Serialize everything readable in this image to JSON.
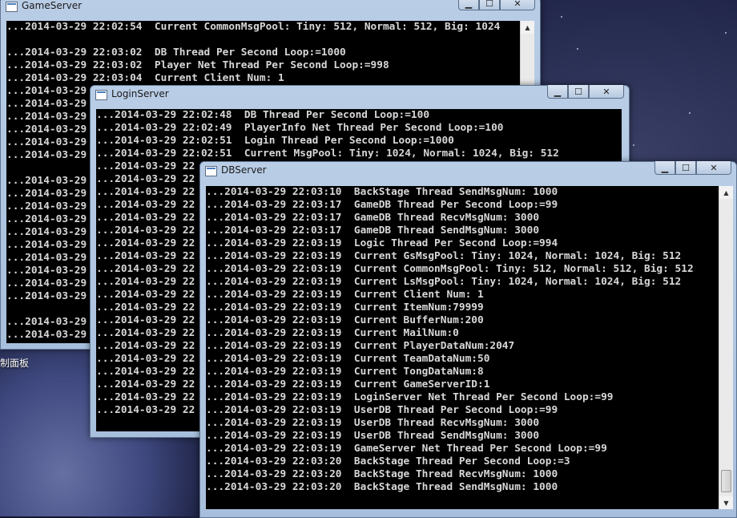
{
  "desktop": {
    "label": "制面板"
  },
  "windows": {
    "game": {
      "title": "GameServer",
      "lines": [
        "...2014-03-29 22:02:54  Current CommonMsgPool: Tiny: 512, Normal: 512, Big: 1024",
        "",
        "...2014-03-29 22:03:02  DB Thread Per Second Loop:=1000",
        "...2014-03-29 22:03:02  Player Net Thread Per Second Loop:=998",
        "...2014-03-29 22:03:04  Current Client Num: 1",
        "...2014-03-29",
        "...2014-03-29",
        "...2014-03-29",
        "...2014-03-29",
        "...2014-03-29",
        "...2014-03-29",
        "",
        "...2014-03-29",
        "...2014-03-29",
        "...2014-03-29",
        "...2014-03-29",
        "...2014-03-29",
        "...2014-03-29",
        "...2014-03-29",
        "...2014-03-29",
        "...2014-03-29",
        "...2014-03-29",
        "",
        "...2014-03-29",
        "...2014-03-29"
      ]
    },
    "login": {
      "title": "LoginServer",
      "lines": [
        "...2014-03-29 22:02:48  DB Thread Per Second Loop:=100",
        "...2014-03-29 22:02:49  PlayerInfo Net Thread Per Second Loop:=100",
        "...2014-03-29 22:02:51  Login Thread Per Second Loop:=1000",
        "...2014-03-29 22:02:51  Current MsgPool: Tiny: 1024, Normal: 1024, Big: 512",
        "...2014-03-29 22",
        "...2014-03-29 22",
        "...2014-03-29 22",
        "...2014-03-29 22",
        "...2014-03-29 22",
        "...2014-03-29 22",
        "...2014-03-29 22",
        "...2014-03-29 22",
        "...2014-03-29 22",
        "...2014-03-29 22",
        "...2014-03-29 22",
        "...2014-03-29 22",
        "...2014-03-29 22",
        "...2014-03-29 22",
        "...2014-03-29 22",
        "...2014-03-29 22",
        "...2014-03-29 22",
        "...2014-03-29 22",
        "...2014-03-29 22",
        "...2014-03-29 22"
      ]
    },
    "db": {
      "title": "DBServer",
      "lines": [
        "...2014-03-29 22:03:10  BackStage Thread SendMsgNum: 1000",
        "...2014-03-29 22:03:17  GameDB Thread Per Second Loop:=99",
        "...2014-03-29 22:03:17  GameDB Thread RecvMsgNum: 3000",
        "...2014-03-29 22:03:17  GameDB Thread SendMsgNum: 3000",
        "...2014-03-29 22:03:19  Logic Thread Per Second Loop:=994",
        "...2014-03-29 22:03:19  Current GsMsgPool: Tiny: 1024, Normal: 1024, Big: 512",
        "...2014-03-29 22:03:19  Current CommonMsgPool: Tiny: 512, Normal: 512, Big: 512",
        "...2014-03-29 22:03:19  Current LsMsgPool: Tiny: 1024, Normal: 1024, Big: 512",
        "...2014-03-29 22:03:19  Current Client Num: 1",
        "...2014-03-29 22:03:19  Current ItemNum:79999",
        "...2014-03-29 22:03:19  Current BufferNum:200",
        "...2014-03-29 22:03:19  Current MailNum:0",
        "...2014-03-29 22:03:19  Current PlayerDataNum:2047",
        "...2014-03-29 22:03:19  Current TeamDataNum:50",
        "...2014-03-29 22:03:19  Current TongDataNum:8",
        "...2014-03-29 22:03:19  Current GameServerID:1",
        "...2014-03-29 22:03:19  LoginServer Net Thread Per Second Loop:=99",
        "...2014-03-29 22:03:19  UserDB Thread Per Second Loop:=99",
        "...2014-03-29 22:03:19  UserDB Thread RecvMsgNum: 3000",
        "...2014-03-29 22:03:19  UserDB Thread SendMsgNum: 3000",
        "...2014-03-29 22:03:19  GameServer Net Thread Per Second Loop:=99",
        "...2014-03-29 22:03:20  BackStage Thread Per Second Loop:=3",
        "...2014-03-29 22:03:20  BackStage Thread RecvMsgNum: 1000",
        "...2014-03-29 22:03:20  BackStage Thread SendMsgNum: 1000"
      ]
    }
  },
  "controls": {
    "minimize": "▁",
    "maximize": "☐",
    "close": "✕"
  },
  "scrollbar": {
    "up": "▲",
    "down": "▼"
  }
}
